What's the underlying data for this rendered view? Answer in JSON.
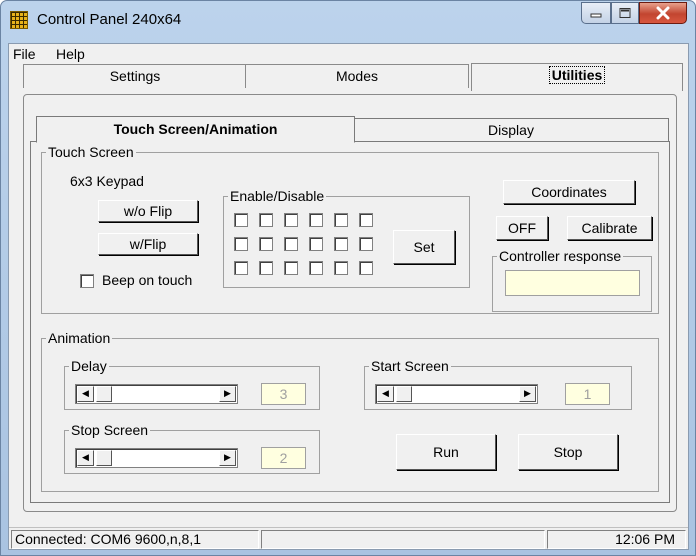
{
  "window": {
    "title": "Control Panel 240x64"
  },
  "menu": {
    "file": "File",
    "help": "Help"
  },
  "outer_tabs": {
    "settings": "Settings",
    "modes": "Modes",
    "utilities": "Utilities",
    "active": "Utilities"
  },
  "inner_tabs": {
    "touch": "Touch Screen/Animation",
    "display": "Display",
    "active": "Touch Screen/Animation"
  },
  "touch_screen": {
    "group_label": "Touch Screen",
    "keypad": {
      "label": "6x3 Keypad",
      "wo_flip": "w/o Flip",
      "w_flip": "w/Flip",
      "beep_label": "Beep on touch",
      "beep_checked": false
    },
    "enable_disable": {
      "label": "Enable/Disable",
      "rows": 3,
      "cols": 6,
      "set_label": "Set"
    },
    "coordinates_label": "Coordinates",
    "off_label": "OFF",
    "calibrate_label": "Calibrate",
    "controller_response": {
      "label": "Controller response",
      "value": ""
    }
  },
  "animation": {
    "group_label": "Animation",
    "delay": {
      "label": "Delay",
      "value": "3"
    },
    "start_screen": {
      "label": "Start Screen",
      "value": "1"
    },
    "stop_screen": {
      "label": "Stop Screen",
      "value": "2"
    },
    "run_label": "Run",
    "stop_label": "Stop"
  },
  "status": {
    "connection": "Connected: COM6 9600,n,8,1",
    "middle": "",
    "time": "12:06 PM"
  },
  "colors": {
    "field_bg": "#ffffe0",
    "close_button": "#c24530"
  }
}
